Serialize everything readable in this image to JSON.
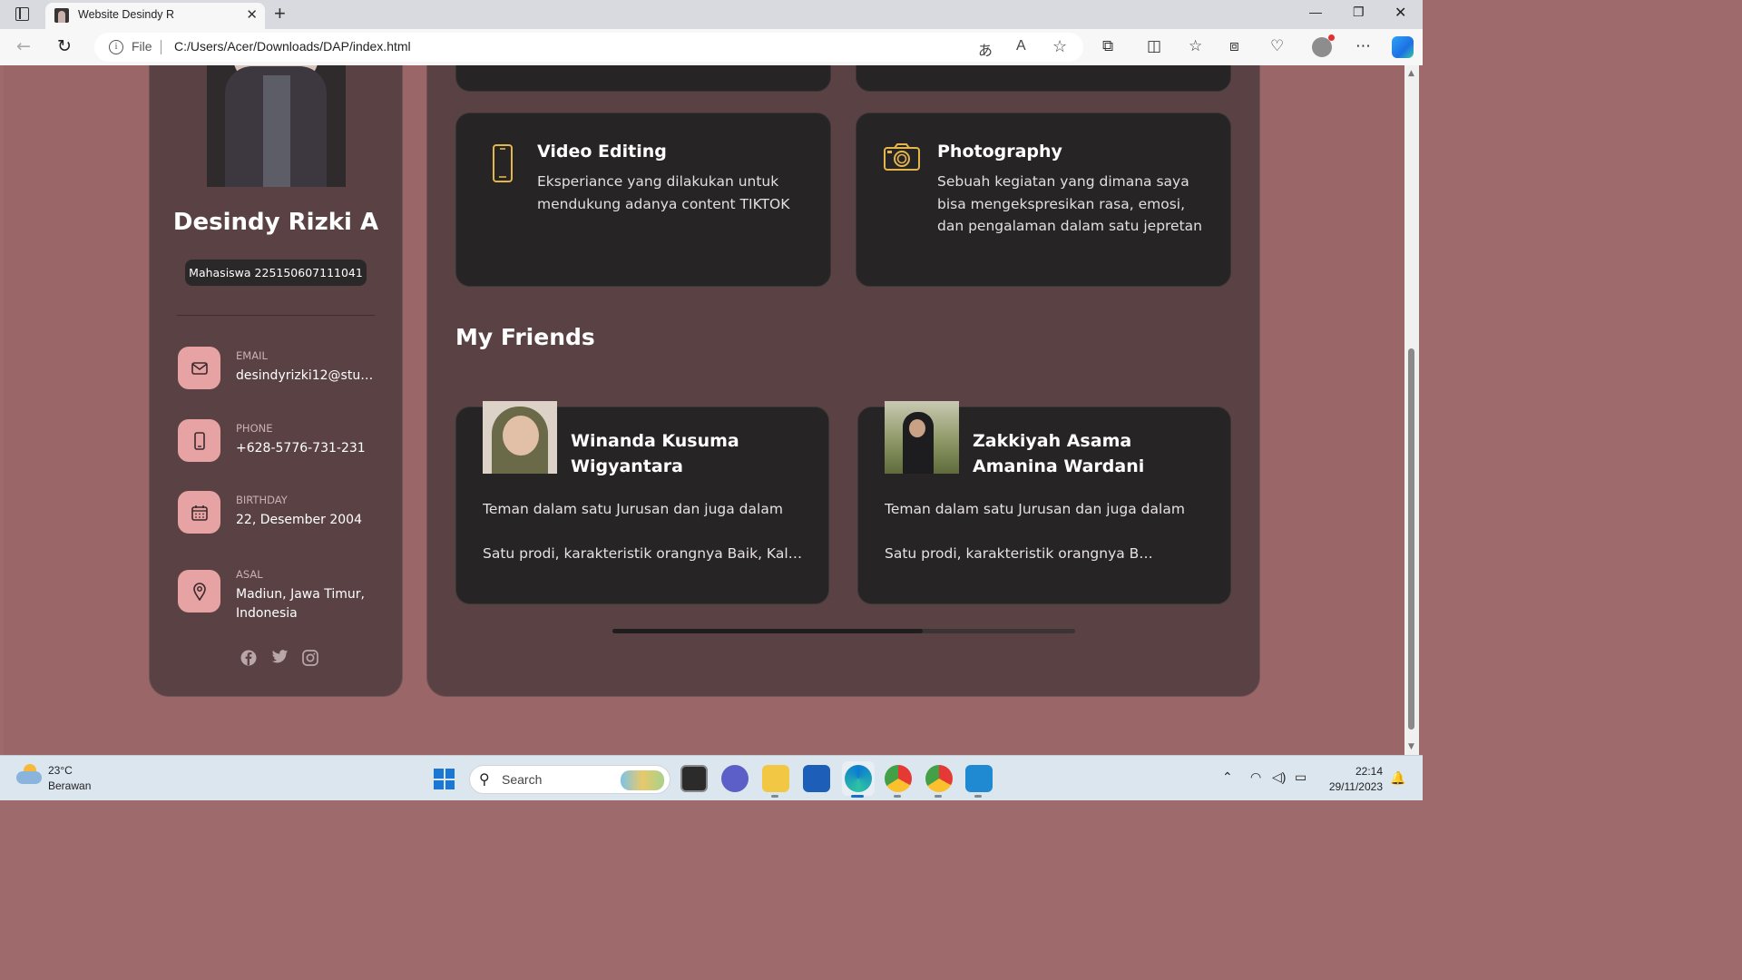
{
  "browser": {
    "tab_title": "Website Desindy R",
    "file_label": "File",
    "url": "C:/Users/Acer/Downloads/DAP/index.html"
  },
  "profile": {
    "name": "Desindy Rizki A",
    "title": "Mahasiswa 225150607111041",
    "contacts": [
      {
        "label": "EMAIL",
        "value": "desindyrizki12@stud...",
        "icon": "mail-icon"
      },
      {
        "label": "PHONE",
        "value": "+628-5776-731-231",
        "icon": "phone-icon"
      },
      {
        "label": "BIRTHDAY",
        "value": "22, Desember 2004",
        "icon": "calendar-icon"
      },
      {
        "label": "ASAL",
        "value": "Madiun, Jawa Timur, Indonesia",
        "icon": "location-icon"
      }
    ],
    "social": [
      "facebook-icon",
      "twitter-icon",
      "instagram-icon"
    ]
  },
  "services": [
    {
      "title": "Video Editing",
      "desc": "Eksperiance yang dilakukan untuk mendukung adanya content TIKTOK",
      "icon": "phone-icon"
    },
    {
      "title": "Photography",
      "desc": "Sebuah kegiatan yang dimana saya bisa mengekspresikan rasa, emosi, dan pengalaman dalam satu jepretan",
      "icon": "camera-icon"
    }
  ],
  "friends_section": {
    "title": "My Friends",
    "friends": [
      {
        "name": "Winanda Kusuma Wigyantara",
        "line1": "Teman dalam satu Jurusan dan juga dalam",
        "line2": "Satu prodi, karakteristik orangnya Baik, Kalem"
      },
      {
        "name": "Zakkiyah Asama Amanina Wardani",
        "line1": "Teman dalam satu Jurusan dan juga dalam",
        "line2": "Satu prodi, karakteristik orangnya Baik,..."
      }
    ],
    "slider_progress": 0.67
  },
  "taskbar": {
    "weather_temp": "23°C",
    "weather_desc": "Berawan",
    "search_placeholder": "Search",
    "time": "22:14",
    "date": "29/11/2023"
  },
  "colors": {
    "page_bg": "#9b6667",
    "panel_bg": "#5a4244",
    "card_bg": "#262425",
    "accent_pink": "#e7a3a3",
    "accent_gold": "#e3b54a"
  }
}
